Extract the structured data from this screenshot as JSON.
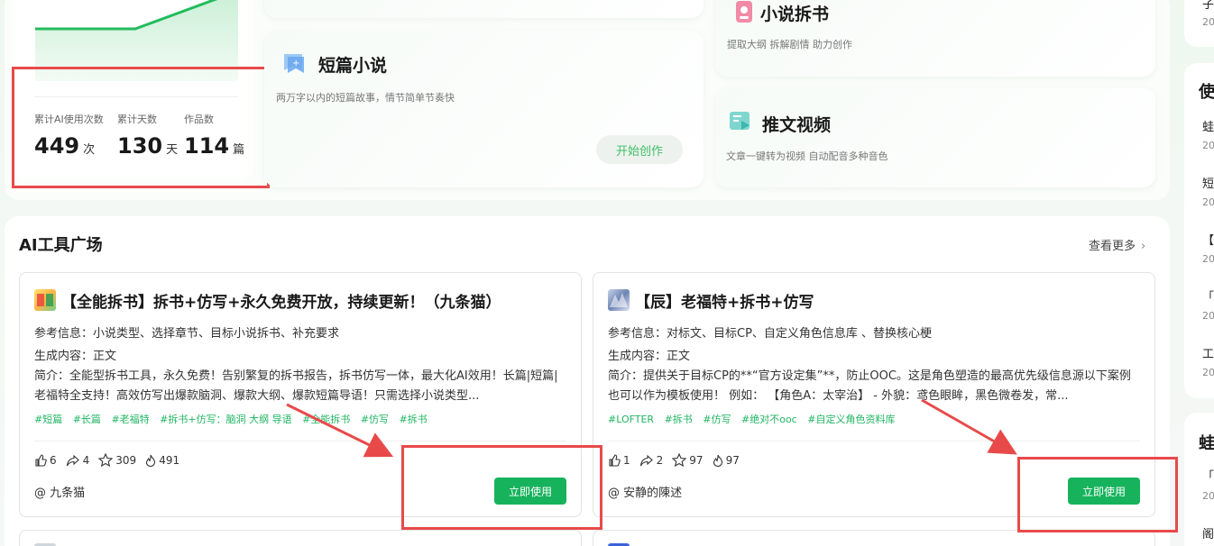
{
  "stats": {
    "labels": [
      "累计AI使用次数",
      "累计天数",
      "作品数"
    ],
    "values": [
      {
        "num": "449",
        "unit": "次"
      },
      {
        "num": "130",
        "unit": "天"
      },
      {
        "num": "114",
        "unit": "篇"
      }
    ]
  },
  "features": {
    "short_novel": {
      "title": "短篇小说",
      "desc": "两万字以内的短篇故事，情节简单节奏快",
      "button": "开始创作"
    },
    "novel_split": {
      "title": "小说拆书",
      "desc": "提取大纲 拆解剧情 助力创作"
    },
    "promo_video": {
      "title": "推文视频",
      "desc": "文章一键转为视频 自动配音多种音色"
    }
  },
  "tool_section": {
    "title": "AI工具广场",
    "see_more": "查看更多"
  },
  "tools": [
    {
      "title": "【全能拆书】拆书+仿写+永久免费开放，持续更新！（九条猫）",
      "ref_info": "参考信息：小说类型、选择章节、目标小说拆书、补充要求",
      "gen_content": "生成内容：正文",
      "desc": "简介：全能型拆书工具，永久免费！告别繁复的拆书报告，拆书仿写一体，最大化AI效用！长篇|短篇|老福特全支持！高效仿写出爆款脑洞、爆款大纲、爆款短篇导语！只需选择小说类型...",
      "tags": [
        "#短篇",
        "#长篇",
        "#老福特",
        "#拆书+仿写：脑洞 大纲 导语",
        "#全能拆书",
        "#仿写",
        "#拆书"
      ],
      "likes": "6",
      "shares": "4",
      "stars": "309",
      "uses": "491",
      "author": "@ 九条猫",
      "button": "立即使用"
    },
    {
      "title": "【辰】老福特+拆书+仿写",
      "ref_info": "参考信息：对标文、目标CP、自定义角色信息库 、替换核心梗",
      "gen_content": "生成内容：正文",
      "desc": "简介：提供关于目标CP的**“官方设定集”**，防止OOC。这是角色塑造的最高优先级信息源以下案例也可以作为模板使用！ 例如： 【角色A：太宰治】 - 外貌：鸢色眼眸，黑色微卷发，常...",
      "tags": [
        "#LOFTER",
        "#拆书",
        "#仿写",
        "#绝对不ooc",
        "#自定义角色资料库"
      ],
      "likes": "1",
      "shares": "2",
      "stars": "97",
      "uses": "97",
      "author": "@ 安静的陳述",
      "button": "立即使用"
    }
  ],
  "sidebar": {
    "top_item": "子",
    "top_date": "20",
    "head1": "使",
    "head2": "蛙",
    "items": [
      {
        "text": "蛙",
        "date": "20"
      },
      {
        "text": "短",
        "date": "20"
      },
      {
        "text": "【",
        "date": "20"
      },
      {
        "text": "「",
        "date": "20"
      },
      {
        "text": "工",
        "date": "20"
      }
    ],
    "items2": [
      {
        "text": "「",
        "date": "20"
      },
      {
        "text": "阁",
        "date": ""
      }
    ]
  },
  "colors": {
    "accent": "#17b35c",
    "tag": "#20b562",
    "annotation": "#e84a4a"
  }
}
